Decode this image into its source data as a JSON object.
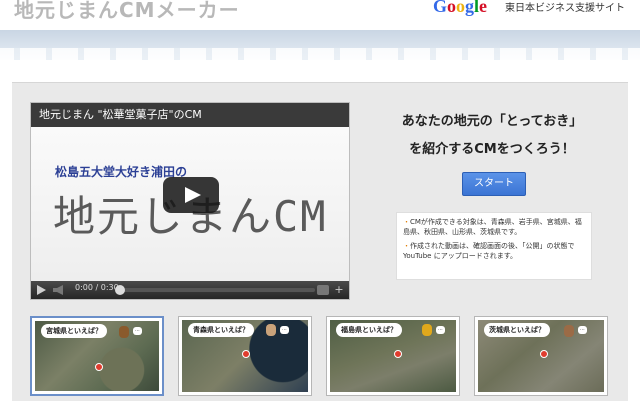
{
  "header": {
    "site_title": "地元じまんCMメーカー",
    "google_logo": [
      "G",
      "o",
      "o",
      "g",
      "l",
      "e"
    ],
    "google_logo_colors": [
      "#3369e8",
      "#d50f25",
      "#eeb211",
      "#3369e8",
      "#009925",
      "#d50f25"
    ],
    "tagline": "東日本ビジネス支援サイト"
  },
  "video": {
    "title": "地元じまん \"松華堂菓子店\"のCM",
    "subtitle": "松島五大堂大好き浦田の",
    "big_title": "地元じまんCM",
    "time": "0:00 / 0:30",
    "progress": 0
  },
  "promo": {
    "headline_line1": "あなたの地元の「とっておき」",
    "headline_line2": "を紹介するCMをつくろう！",
    "start_label": "スタート"
  },
  "info": {
    "bullet": "・",
    "items": [
      "CMが作成できる対象は、青森県、岩手県、宮城県、福島県、秋田県、山形県、茨城県です。",
      "作成された動画は、確認画面の後、「公開」の状態でYouTube にアップロードされます。"
    ]
  },
  "thumbnails": [
    {
      "caption": "宮城県といえば？",
      "selected": true
    },
    {
      "caption": "青森県といえば？",
      "selected": false
    },
    {
      "caption": "福島県といえば？",
      "selected": false
    },
    {
      "caption": "茨城県といえば？",
      "selected": false
    }
  ],
  "colors": {
    "accent": "#3b74d4",
    "video_title_bg": "#3a3a3a",
    "panel_bg": "#e9e9e9"
  }
}
